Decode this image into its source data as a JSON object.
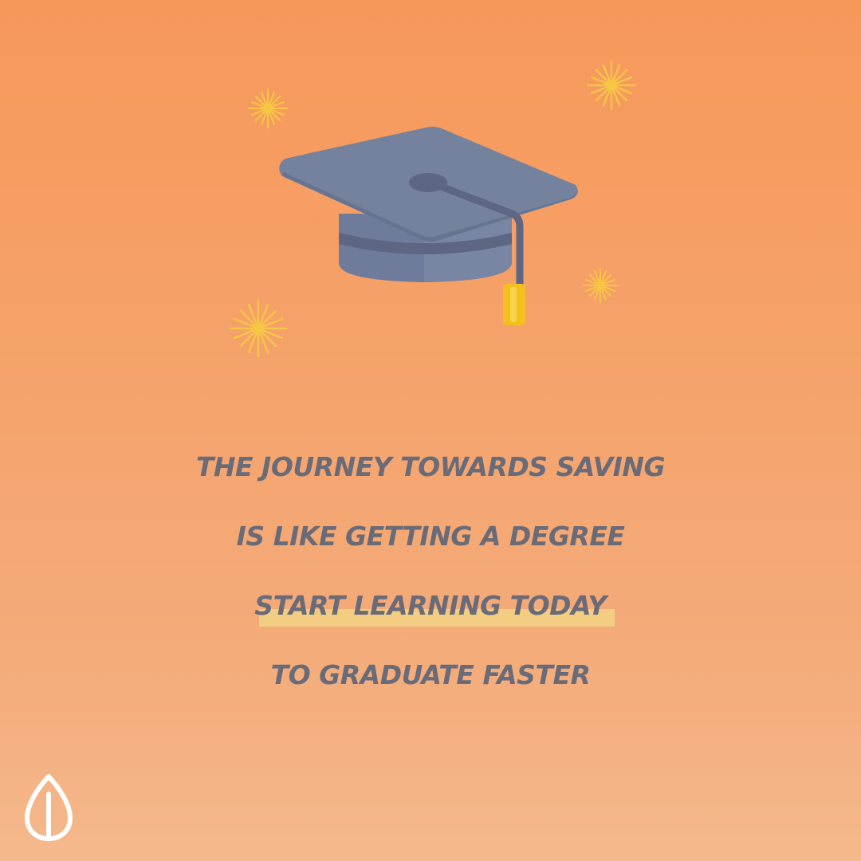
{
  "message": {
    "lines": [
      "THE JOURNEY TOWARDS SAVING",
      "IS LIKE GETTING A DEGREE",
      "START LEARNING TODAY",
      "TO GRADUATE FASTER"
    ],
    "highlighted_line_index": 2
  },
  "illustration": {
    "icon": "graduation-cap-icon",
    "sparkle_icon": "sparkle-icon",
    "sparkle_count": 4
  },
  "brand": {
    "logo_icon": "seed-logo-icon"
  },
  "colors": {
    "background_top": "#f6985a",
    "background_bottom": "#f4b98c",
    "text": "#6a6b78",
    "highlight": "#f3cd82",
    "cap": "#74829e",
    "cap_dark": "#5d6682",
    "tassel": "#f4c020",
    "sparkle": "#f6c744",
    "logo": "#ffffff"
  }
}
